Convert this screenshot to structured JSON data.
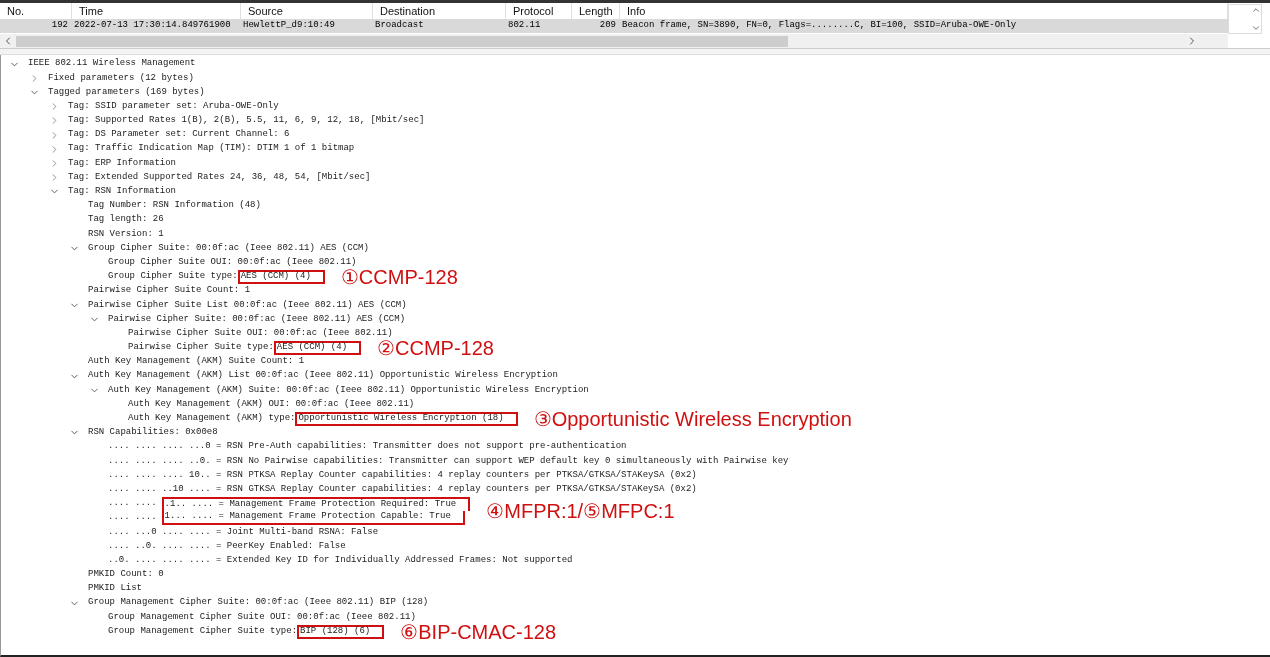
{
  "packet_list": {
    "columns": [
      "No.",
      "Time",
      "Source",
      "Destination",
      "Protocol",
      "Length",
      "Info"
    ],
    "rows": [
      {
        "selected": true,
        "cells": [
          "192",
          "2022-07-13 17:30:14.849761900",
          "HewlettP_d9:10:49",
          "Broadcast",
          "802.11",
          "209",
          "Beacon frame, SN=3890, FN=0, Flags=........C, BI=100, SSID=Aruba-OWE-Only"
        ]
      }
    ]
  },
  "details": {
    "tree": [
      {
        "text": "IEEE 802.11 Wireless Management",
        "expanded": true,
        "children": [
          {
            "text": "Fixed parameters (12 bytes)",
            "expanded": false
          },
          {
            "text": "Tagged parameters (169 bytes)",
            "expanded": true,
            "children": [
              {
                "text": "Tag: SSID parameter set: Aruba-OWE-Only",
                "expanded": false
              },
              {
                "text": "Tag: Supported Rates 1(B), 2(B), 5.5, 11, 6, 9, 12, 18, [Mbit/sec]",
                "expanded": false
              },
              {
                "text": "Tag: DS Parameter set: Current Channel: 6",
                "expanded": false
              },
              {
                "text": "Tag: Traffic Indication Map (TIM): DTIM 1 of 1 bitmap",
                "expanded": false
              },
              {
                "text": "Tag: ERP Information",
                "expanded": false
              },
              {
                "text": "Tag: Extended Supported Rates 24, 36, 48, 54, [Mbit/sec]",
                "expanded": false
              },
              {
                "text": "Tag: RSN Information",
                "expanded": true,
                "children": [
                  {
                    "text": "Tag Number: RSN Information (48)"
                  },
                  {
                    "text": "Tag length: 26"
                  },
                  {
                    "text": "RSN Version: 1"
                  },
                  {
                    "text": "Group Cipher Suite: 00:0f:ac (Ieee 802.11) AES (CCM)",
                    "expanded": true,
                    "children": [
                      {
                        "text": "Group Cipher Suite OUI: 00:0f:ac (Ieee 802.11)"
                      },
                      {
                        "text": "Group Cipher Suite type:",
                        "boxed": "AES (CCM) (4)",
                        "note": "①CCMP-128"
                      }
                    ]
                  },
                  {
                    "text": "Pairwise Cipher Suite Count: 1"
                  },
                  {
                    "text": "Pairwise Cipher Suite List 00:0f:ac (Ieee 802.11) AES (CCM)",
                    "expanded": true,
                    "children": [
                      {
                        "text": "Pairwise Cipher Suite: 00:0f:ac (Ieee 802.11) AES (CCM)",
                        "expanded": true,
                        "children": [
                          {
                            "text": "Pairwise Cipher Suite OUI: 00:0f:ac (Ieee 802.11)"
                          },
                          {
                            "text": "Pairwise Cipher Suite type:",
                            "boxed": "AES (CCM) (4)",
                            "note": "②CCMP-128"
                          }
                        ]
                      }
                    ]
                  },
                  {
                    "text": "Auth Key Management (AKM) Suite Count: 1"
                  },
                  {
                    "text": "Auth Key Management (AKM) List 00:0f:ac (Ieee 802.11) Opportunistic Wireless Encryption",
                    "expanded": true,
                    "children": [
                      {
                        "text": "Auth Key Management (AKM) Suite: 00:0f:ac (Ieee 802.11) Opportunistic Wireless Encryption",
                        "expanded": true,
                        "children": [
                          {
                            "text": "Auth Key Management (AKM) OUI: 00:0f:ac (Ieee 802.11)"
                          },
                          {
                            "text": "Auth Key Management (AKM) type:",
                            "boxed": "Opportunistic Wireless Encryption (18)",
                            "note": "③Opportunistic Wireless Encryption"
                          }
                        ]
                      }
                    ]
                  },
                  {
                    "text": "RSN Capabilities: 0x00e8",
                    "expanded": true,
                    "children": [
                      {
                        "text": ".... .... .... ...0 = RSN Pre-Auth capabilities: Transmitter does not support pre-authentication"
                      },
                      {
                        "text": ".... .... .... ..0. = RSN No Pairwise capabilities: Transmitter can support WEP default key 0 simultaneously with Pairwise key"
                      },
                      {
                        "text": ".... .... .... 10.. = RSN PTKSA Replay Counter capabilities: 4 replay counters per PTKSA/GTKSA/STAKeySA (0x2)"
                      },
                      {
                        "text": ".... .... ..10 .... = RSN GTKSA Replay Counter capabilities: 4 replay counters per PTKSA/GTKSA/STAKeySA (0x2)"
                      },
                      {
                        "text": ".... ....",
                        "boxed": ".1.. .... = Management Frame Protection Required: True",
                        "note": "④MFPR:1/⑤MFPC:1"
                      },
                      {
                        "text": ".... ....",
                        "boxed": "1... .... = Management Frame Protection Capable: True"
                      },
                      {
                        "text": ".... ...0 .... .... = Joint Multi-band RSNA: False"
                      },
                      {
                        "text": ".... ..0. .... .... = PeerKey Enabled: False"
                      },
                      {
                        "text": "..0. .... .... .... = Extended Key ID for Individually Addressed Frames: Not supported"
                      }
                    ]
                  },
                  {
                    "text": "PMKID Count: 0"
                  },
                  {
                    "text": "PMKID List"
                  },
                  {
                    "text": "Group Management Cipher Suite: 00:0f:ac (Ieee 802.11) BIP (128)",
                    "expanded": true,
                    "children": [
                      {
                        "text": "Group Management Cipher Suite OUI: 00:0f:ac (Ieee 802.11)"
                      },
                      {
                        "text": "Group Management Cipher Suite type:",
                        "boxed": "BIP (128) (6)",
                        "note": "⑥BIP-CMAC-128"
                      }
                    ]
                  }
                ]
              }
            ]
          }
        ]
      }
    ]
  }
}
